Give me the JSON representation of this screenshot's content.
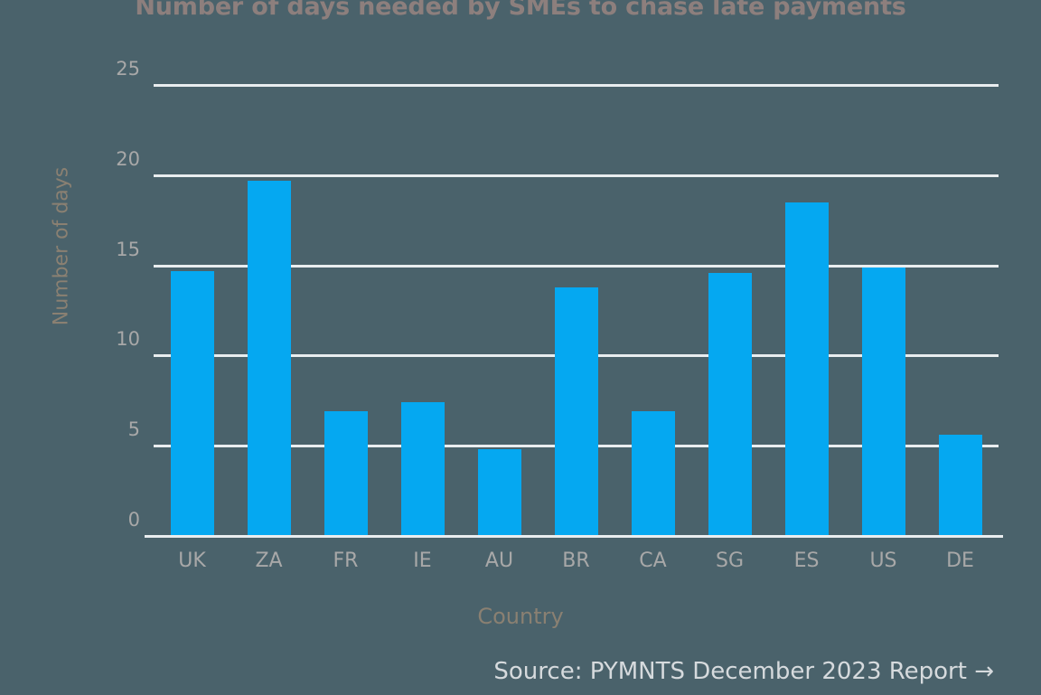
{
  "theme": {
    "background": "#4a626b",
    "bar_color": "#05a8f1",
    "grid_color": "#e9edef",
    "tick_label_color": "#a8a8a8",
    "axis_title_color": "#8a8072",
    "title_color": "#8d7f7d",
    "source_color": "#d6dadd"
  },
  "source": {
    "text": "Source: PYMNTS December 2023 Report →"
  },
  "chart_data": {
    "type": "bar",
    "title": "Number of days needed by SMEs to chase late payments",
    "xlabel": "Country",
    "ylabel": "Number of days",
    "categories": [
      "UK",
      "ZA",
      "FR",
      "IE",
      "AU",
      "BR",
      "CA",
      "SG",
      "ES",
      "US",
      "DE"
    ],
    "values": [
      14.7,
      19.7,
      6.9,
      7.4,
      4.8,
      13.8,
      6.9,
      14.6,
      18.5,
      14.9,
      5.6
    ],
    "ylim": [
      0,
      26
    ],
    "yticks": [
      0,
      5,
      10,
      15,
      20,
      25
    ],
    "ytick_labels": [
      "0",
      "5",
      "10",
      "15",
      "20",
      "25"
    ],
    "grid": true,
    "grid_axis": "y",
    "legend": false
  }
}
